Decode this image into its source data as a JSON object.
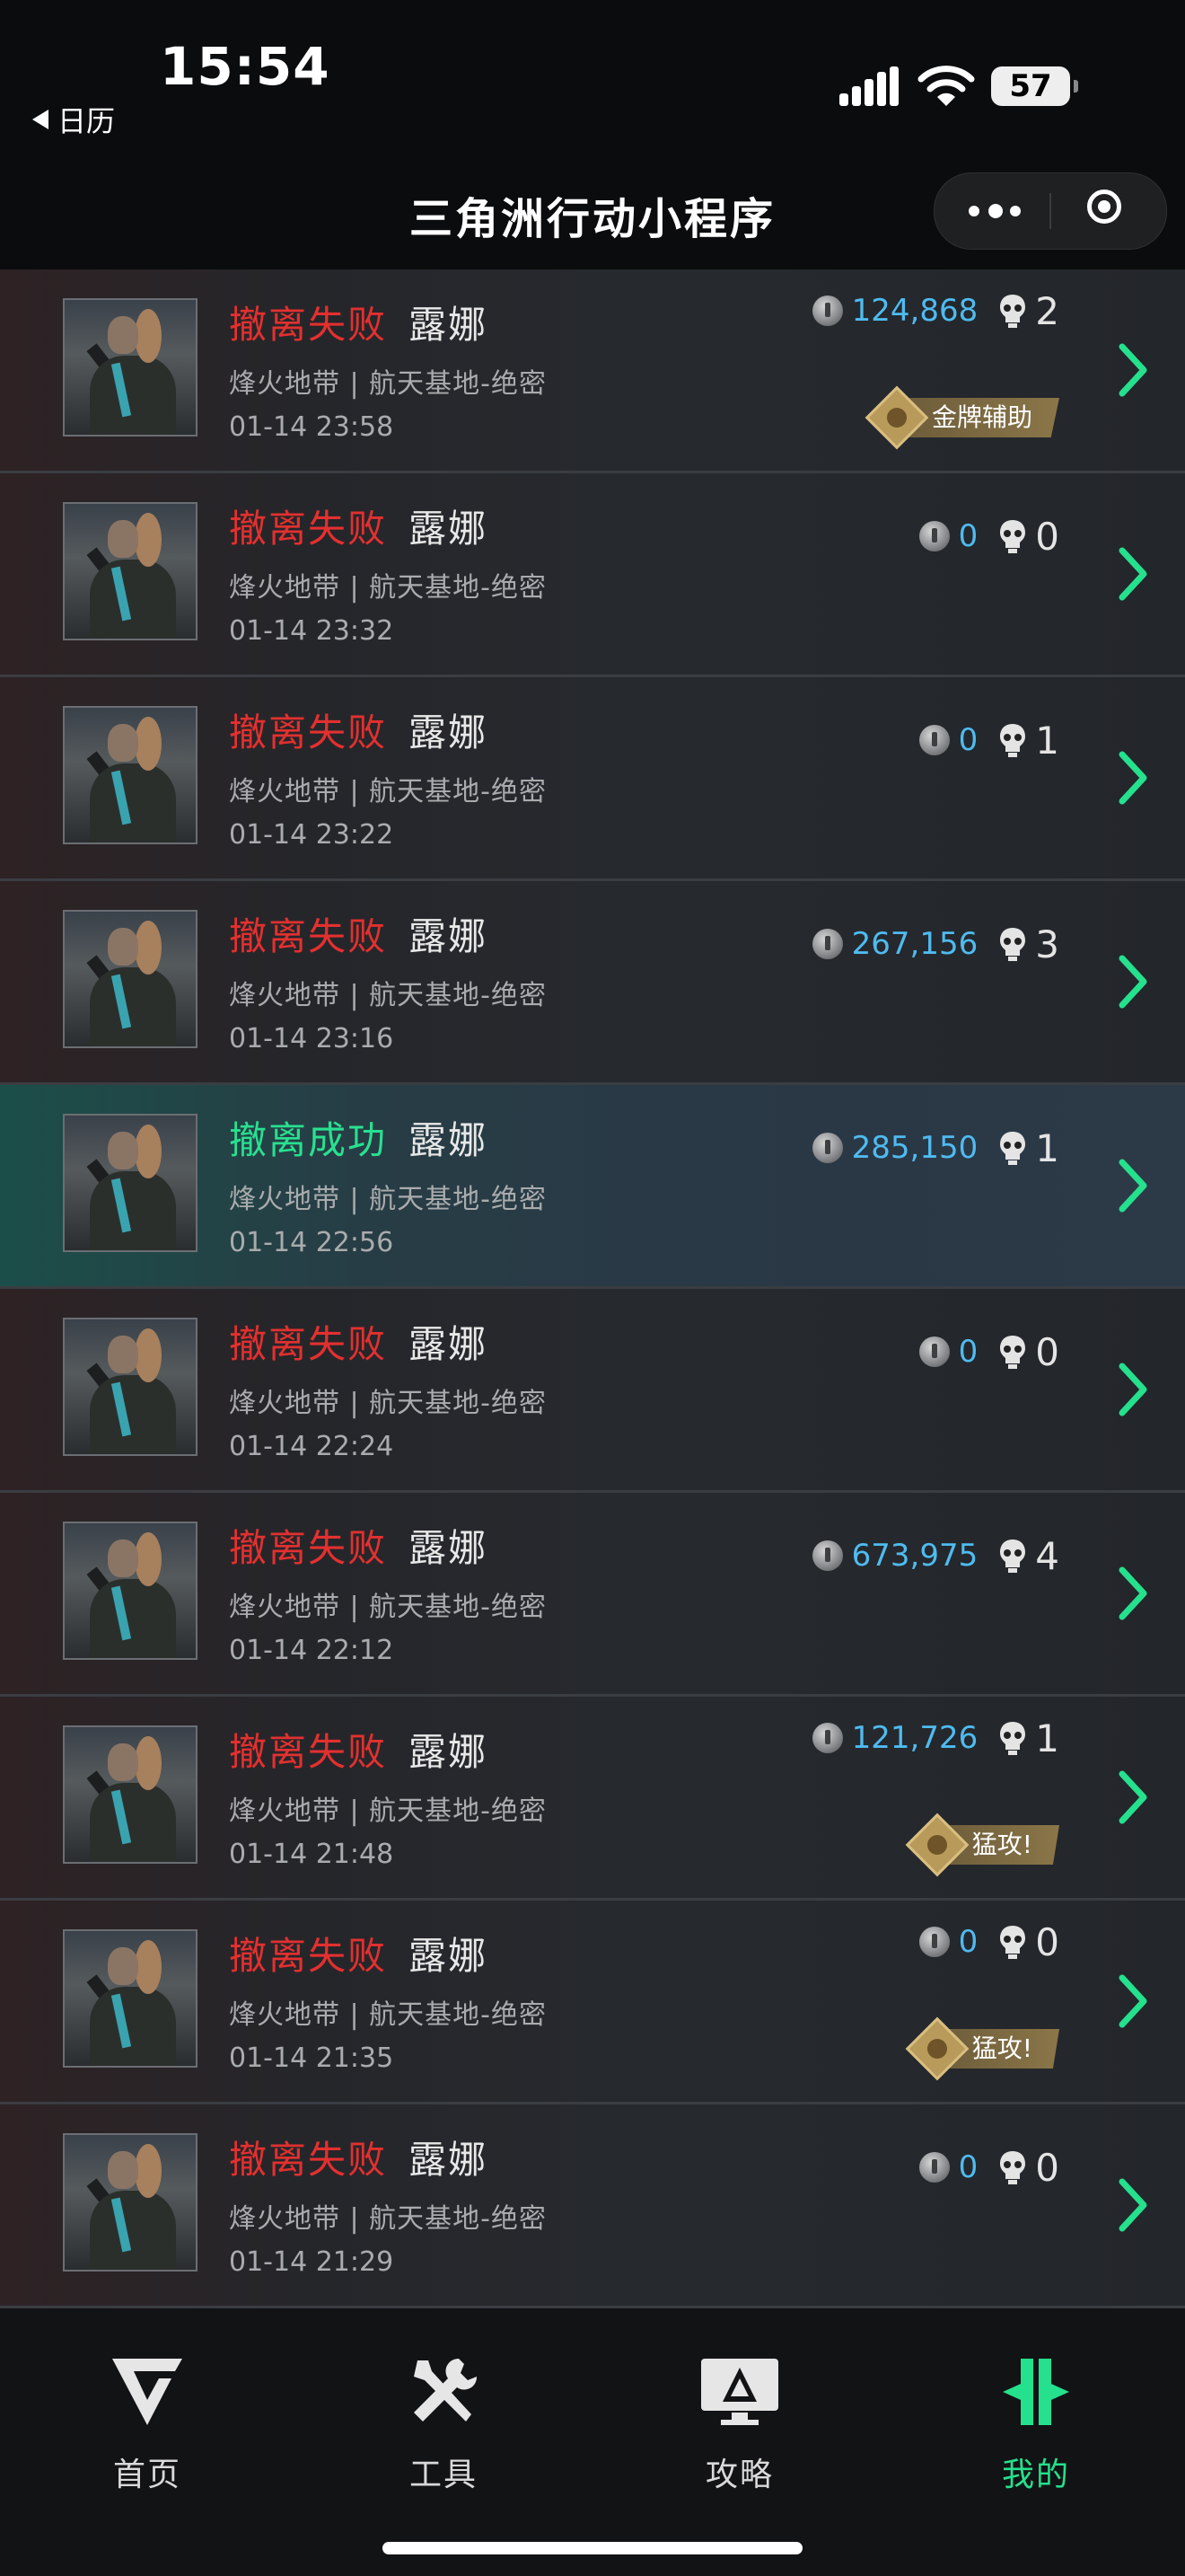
{
  "status_bar": {
    "time": "15:54",
    "back_app": "日历",
    "battery": "57"
  },
  "nav": {
    "title": "三角洲行动小程序"
  },
  "colors": {
    "fail": "#e3302f",
    "success": "#28e090",
    "value": "#4fbbf0",
    "active_tab": "#25e08d"
  },
  "matches": [
    {
      "status": "撤离失败",
      "result": "fail",
      "operator": "露娜",
      "map": "烽火地带 | 航天基地-绝密",
      "time": "01-14 23:58",
      "value": "124,868",
      "kills": "2",
      "badge": "金牌辅助"
    },
    {
      "status": "撤离失败",
      "result": "fail",
      "operator": "露娜",
      "map": "烽火地带 | 航天基地-绝密",
      "time": "01-14 23:32",
      "value": "0",
      "kills": "0",
      "badge": ""
    },
    {
      "status": "撤离失败",
      "result": "fail",
      "operator": "露娜",
      "map": "烽火地带 | 航天基地-绝密",
      "time": "01-14 23:22",
      "value": "0",
      "kills": "1",
      "badge": ""
    },
    {
      "status": "撤离失败",
      "result": "fail",
      "operator": "露娜",
      "map": "烽火地带 | 航天基地-绝密",
      "time": "01-14 23:16",
      "value": "267,156",
      "kills": "3",
      "badge": ""
    },
    {
      "status": "撤离成功",
      "result": "success",
      "operator": "露娜",
      "map": "烽火地带 | 航天基地-绝密",
      "time": "01-14 22:56",
      "value": "285,150",
      "kills": "1",
      "badge": ""
    },
    {
      "status": "撤离失败",
      "result": "fail",
      "operator": "露娜",
      "map": "烽火地带 | 航天基地-绝密",
      "time": "01-14 22:24",
      "value": "0",
      "kills": "0",
      "badge": ""
    },
    {
      "status": "撤离失败",
      "result": "fail",
      "operator": "露娜",
      "map": "烽火地带 | 航天基地-绝密",
      "time": "01-14 22:12",
      "value": "673,975",
      "kills": "4",
      "badge": ""
    },
    {
      "status": "撤离失败",
      "result": "fail",
      "operator": "露娜",
      "map": "烽火地带 | 航天基地-绝密",
      "time": "01-14 21:48",
      "value": "121,726",
      "kills": "1",
      "badge": "猛攻!"
    },
    {
      "status": "撤离失败",
      "result": "fail",
      "operator": "露娜",
      "map": "烽火地带 | 航天基地-绝密",
      "time": "01-14 21:35",
      "value": "0",
      "kills": "0",
      "badge": "猛攻!"
    },
    {
      "status": "撤离失败",
      "result": "fail",
      "operator": "露娜",
      "map": "烽火地带 | 航天基地-绝密",
      "time": "01-14 21:29",
      "value": "0",
      "kills": "0",
      "badge": ""
    }
  ],
  "tabbar": {
    "items": [
      {
        "label": "首页",
        "icon": "home-v-logo-icon",
        "active": false
      },
      {
        "label": "工具",
        "icon": "tools-icon",
        "active": false
      },
      {
        "label": "攻略",
        "icon": "guide-monitor-icon",
        "active": false
      },
      {
        "label": "我的",
        "icon": "profile-logo-icon",
        "active": true
      }
    ]
  }
}
